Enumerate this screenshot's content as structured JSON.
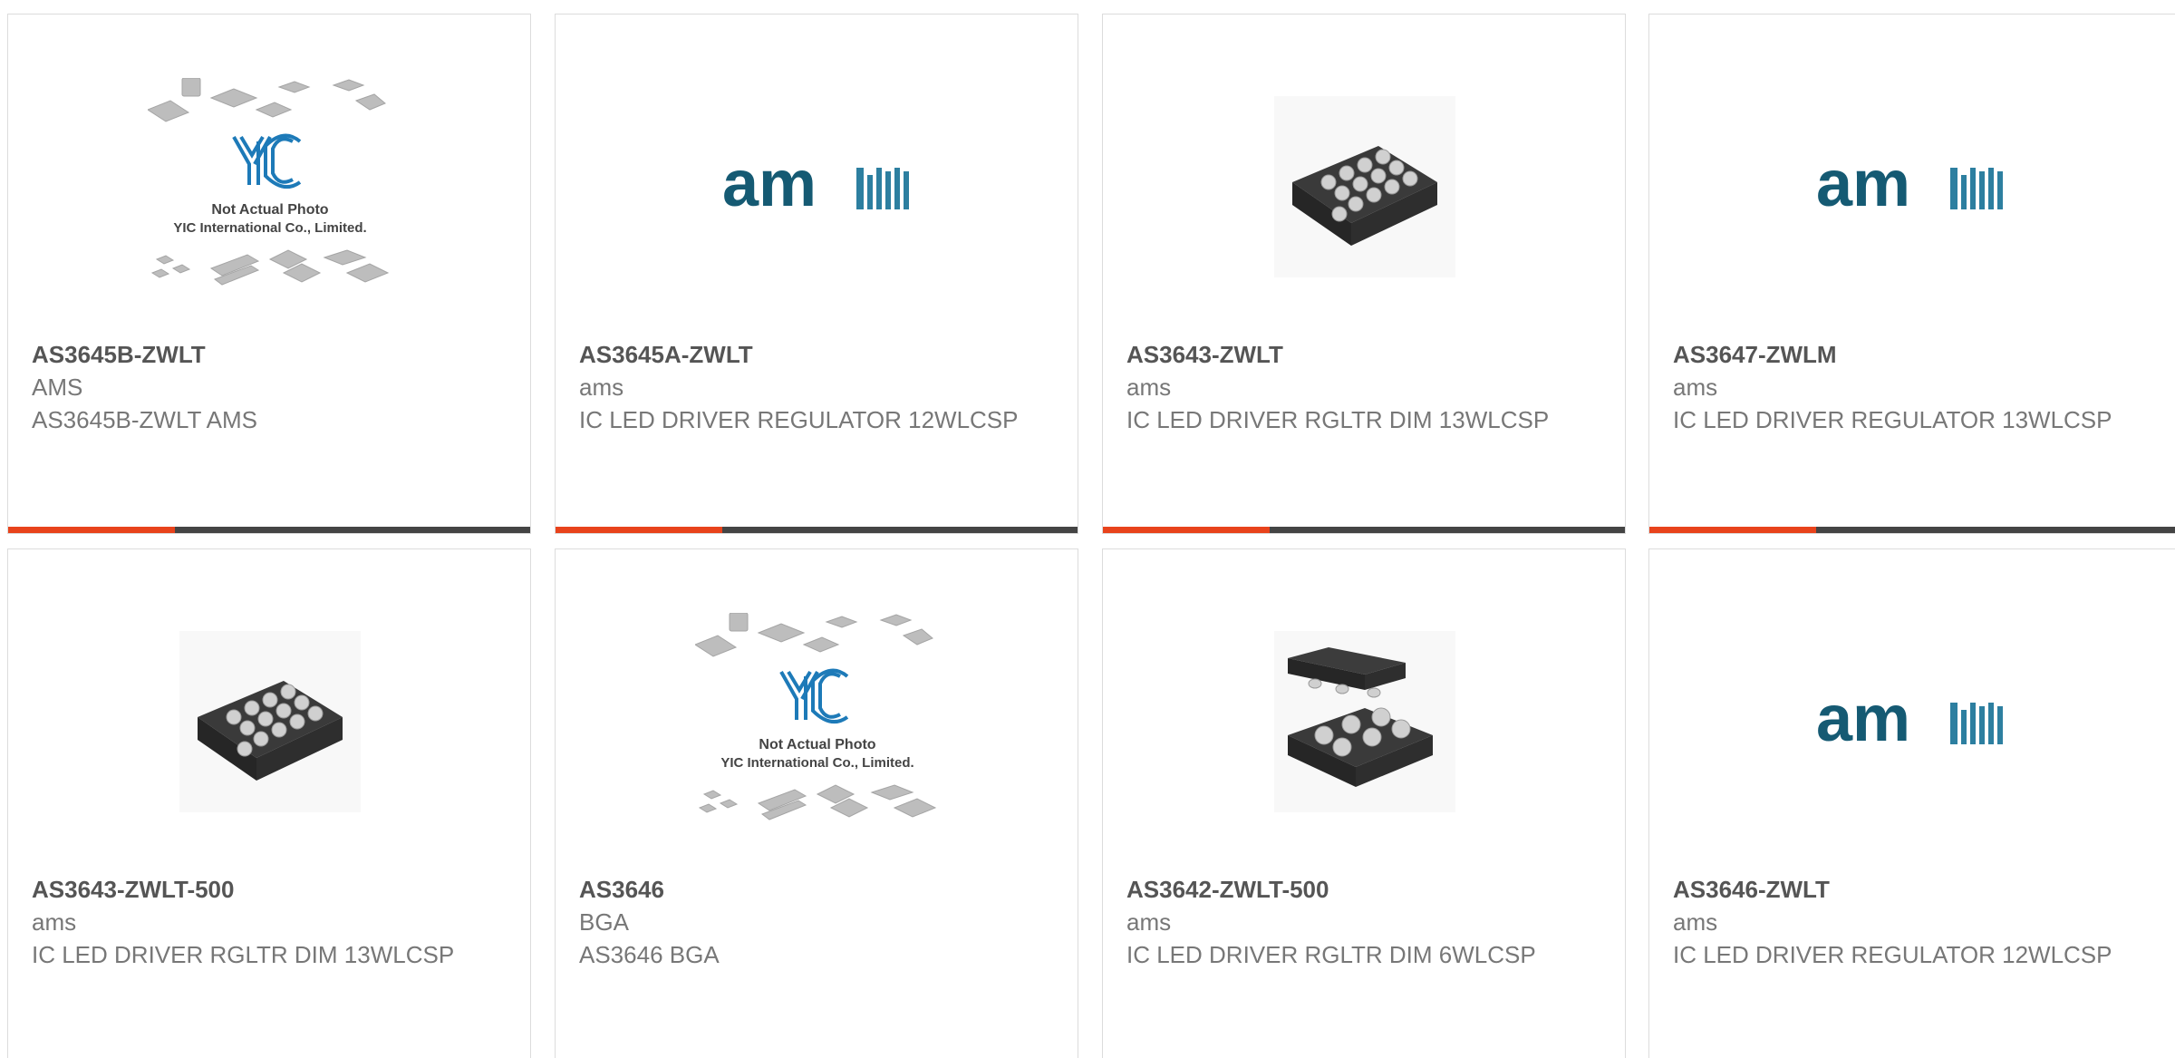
{
  "products": [
    {
      "part": "AS3645B-ZWLT",
      "brand": "AMS",
      "desc": "AS3645B-ZWLT AMS",
      "image": "placeholder-photo-icon"
    },
    {
      "part": "AS3645A-ZWLT",
      "brand": "ams",
      "desc": "IC LED DRIVER REGULATOR 12WLCSP",
      "image": "ams-logo-icon"
    },
    {
      "part": "AS3643-ZWLT",
      "brand": "ams",
      "desc": "IC LED DRIVER RGLTR DIM 13WLCSP",
      "image": "bga-chip-icon"
    },
    {
      "part": "AS3647-ZWLM",
      "brand": "ams",
      "desc": "IC LED DRIVER REGULATOR 13WLCSP",
      "image": "ams-logo-icon"
    },
    {
      "part": "AS3643-ZWLT-500",
      "brand": "ams",
      "desc": "IC LED DRIVER RGLTR DIM 13WLCSP",
      "image": "bga-chip-icon"
    },
    {
      "part": "AS3646",
      "brand": "BGA",
      "desc": "AS3646 BGA",
      "image": "placeholder-photo-icon"
    },
    {
      "part": "AS3642-ZWLT-500",
      "brand": "ams",
      "desc": "IC LED DRIVER RGLTR DIM 6WLCSP",
      "image": "stacked-chip-icon"
    },
    {
      "part": "AS3646-ZWLT",
      "brand": "ams",
      "desc": "IC LED DRIVER REGULATOR 12WLCSP",
      "image": "ams-logo-icon"
    }
  ],
  "placeholder": {
    "logo_text": "YIC",
    "line1": "Not Actual Photo",
    "line2": "YIC International Co., Limited."
  },
  "logo_text": "am",
  "colors": {
    "accent": "#e8431c",
    "bar": "#444444",
    "brand_teal": "#155a73",
    "border": "#dcdcdc"
  }
}
